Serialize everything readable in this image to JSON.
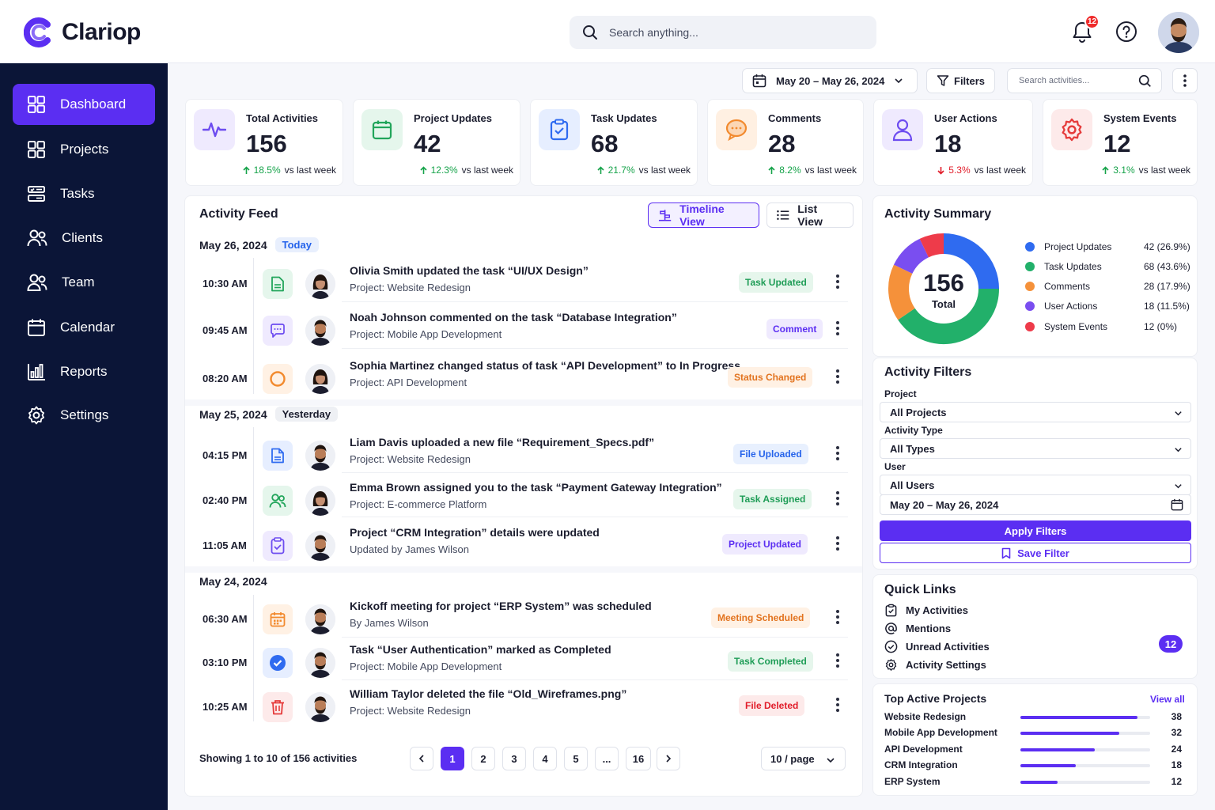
{
  "brand": {
    "name": "Clariop",
    "accent": "#5b2ef2",
    "sidebar_bg": "#0b1537"
  },
  "header": {
    "search_placeholder": "Search anything...",
    "notifications_count": "12",
    "icons": [
      "search-icon",
      "bell-icon",
      "help-icon",
      "user-avatar"
    ]
  },
  "sidebar": {
    "items": [
      {
        "label": "Dashboard",
        "icon": "dashboard-icon",
        "active": true
      },
      {
        "label": "Projects",
        "icon": "projects-icon"
      },
      {
        "label": "Tasks",
        "icon": "tasks-icon"
      },
      {
        "label": "Clients",
        "icon": "clients-icon"
      },
      {
        "label": "Team",
        "icon": "team-icon"
      },
      {
        "label": "Calendar",
        "icon": "calendar-icon"
      },
      {
        "label": "Reports",
        "icon": "reports-icon"
      },
      {
        "label": "Settings",
        "icon": "settings-icon"
      }
    ]
  },
  "toolbar": {
    "date_range": "May 20 – May 26, 2024",
    "filters_label": "Filters",
    "search_placeholder": "Search activities..."
  },
  "stats": [
    {
      "label": "Total Activities",
      "value": "156",
      "delta": "18.5%",
      "trend": "up",
      "vs": "vs last week",
      "color": "#6d4cf0"
    },
    {
      "label": "Project Updates",
      "value": "42",
      "delta": "12.3%",
      "trend": "up",
      "vs": "vs last week",
      "color": "#22a55b"
    },
    {
      "label": "Task Updates",
      "value": "68",
      "delta": "21.7%",
      "trend": "up",
      "vs": "vs last week",
      "color": "#2f6bf0"
    },
    {
      "label": "Comments",
      "value": "28",
      "delta": "8.2%",
      "trend": "up",
      "vs": "vs last week",
      "color": "#f28a2e"
    },
    {
      "label": "User Actions",
      "value": "18",
      "delta": "5.3%",
      "trend": "down",
      "vs": "vs last week",
      "color": "#6d4cf0"
    },
    {
      "label": "System Events",
      "value": "12",
      "delta": "3.1%",
      "trend": "up",
      "vs": "vs last week",
      "color": "#e53a3a"
    }
  ],
  "feed": {
    "title": "Activity Feed",
    "timeline_view": "Timeline View",
    "list_view": "List View",
    "days": [
      {
        "date": "May 26, 2024",
        "badge": "Today"
      },
      {
        "date": "May 25, 2024",
        "badge": "Yesterday"
      },
      {
        "date": "May 24, 2024",
        "badge": ""
      }
    ],
    "rows": [
      {
        "time": "10:30 AM",
        "icon": "document-icon",
        "title": "Olivia Smith updated the task “UI/UX Design”",
        "sub": "Project: Website Redesign",
        "tag": "Task Updated",
        "tag_color": "#1f9d57",
        "tag_bg": "#e6f6ec",
        "avatar": "female"
      },
      {
        "time": "09:45 AM",
        "icon": "comment-icon",
        "title": "Noah Johnson commented on the task “Database Integration”",
        "sub": "Project: Mobile App Development",
        "tag": "Comment",
        "tag_color": "#5b2ef2",
        "tag_bg": "#efeafe",
        "avatar": "male"
      },
      {
        "time": "08:20 AM",
        "icon": "status-circle-icon",
        "title": "Sophia Martinez changed status of task “API Development” to In Progress",
        "sub": "Project: API Development",
        "tag": "Status Changed",
        "tag_color": "#e2731f",
        "tag_bg": "#fff1e4",
        "avatar": "female"
      },
      {
        "time": "04:15 PM",
        "icon": "file-icon",
        "title": "Liam Davis uploaded a new file “Requirement_Specs.pdf”",
        "sub": "Project: Website Redesign",
        "tag": "File Uploaded",
        "tag_color": "#2563eb",
        "tag_bg": "#e8f0fe",
        "avatar": "male"
      },
      {
        "time": "02:40 PM",
        "icon": "users-icon",
        "title": "Emma Brown assigned you to the task “Payment Gateway Integration”",
        "sub": "Project: E-commerce Platform",
        "tag": "Task Assigned",
        "tag_color": "#1f9d57",
        "tag_bg": "#e6f6ec",
        "avatar": "female"
      },
      {
        "time": "11:05 AM",
        "icon": "clipboard-icon",
        "title": "Project “CRM Integration” details were updated",
        "sub": "Updated by James Wilson",
        "tag": "Project Updated",
        "tag_color": "#5b2ef2",
        "tag_bg": "#efeafe",
        "avatar": "male"
      },
      {
        "time": "06:30 AM",
        "icon": "calendar-icon",
        "title": "Kickoff meeting for project “ERP System” was scheduled",
        "sub": "By James Wilson",
        "tag": "Meeting Scheduled",
        "tag_color": "#e2731f",
        "tag_bg": "#fff1e4",
        "avatar": "male"
      },
      {
        "time": "03:10 PM",
        "icon": "check-circle-icon",
        "title": "Task “User Authentication” marked as Completed",
        "sub": "Project: Mobile App Development",
        "tag": "Task Completed",
        "tag_color": "#1f9d57",
        "tag_bg": "#e6f6ec",
        "avatar": "male"
      },
      {
        "time": "10:25 AM",
        "icon": "trash-icon",
        "title": "William Taylor deleted the file “Old_Wireframes.png”",
        "sub": "Project: Website Redesign",
        "tag": "File Deleted",
        "tag_color": "#e11d2a",
        "tag_bg": "#fdeaea",
        "avatar": "male"
      }
    ],
    "showing": "Showing 1 to 10 of 156 activities",
    "pages": [
      "1",
      "2",
      "3",
      "4",
      "5",
      "...",
      "16"
    ],
    "per_page": "10 / page"
  },
  "summary": {
    "title": "Activity Summary",
    "total": "156",
    "total_label": "Total",
    "legend": [
      {
        "label": "Project Updates",
        "value": "42 (26.9%)",
        "color": "#2f6bf0"
      },
      {
        "label": "Task Updates",
        "value": "68 (43.6%)",
        "color": "#22b06a"
      },
      {
        "label": "Comments",
        "value": "28 (17.9%)",
        "color": "#f5913a"
      },
      {
        "label": "User Actions",
        "value": "18 (11.5%)",
        "color": "#7a4ef0"
      },
      {
        "label": "System Events",
        "value": "12 (0%)",
        "color": "#ee3b4a"
      }
    ]
  },
  "chart_data": {
    "type": "pie",
    "categories": [
      "Project Updates",
      "Task Updates",
      "Comments",
      "User Actions",
      "System Events"
    ],
    "values": [
      42,
      68,
      28,
      18,
      12
    ]
  },
  "filters": {
    "title": "Activity Filters",
    "project_label": "Project",
    "project_value": "All Projects",
    "type_label": "Activity Type",
    "type_value": "All Types",
    "user_label": "User",
    "user_value": "All Users",
    "date_value": "May 20 – May 26, 2024",
    "apply": "Apply Filters",
    "save": "Save Filter"
  },
  "quick_links": {
    "title": "Quick Links",
    "items": [
      "My Activities",
      "Mentions",
      "Unread Activities",
      "Activity Settings"
    ],
    "unread_count": "12"
  },
  "top_projects": {
    "title": "Top Active Projects",
    "view_all": "View all",
    "items": [
      {
        "name": "Website Redesign",
        "value": 38
      },
      {
        "name": "Mobile App Development",
        "value": 32
      },
      {
        "name": "API Development",
        "value": 24
      },
      {
        "name": "CRM Integration",
        "value": 18
      },
      {
        "name": "ERP System",
        "value": 12
      }
    ],
    "max": 42
  }
}
